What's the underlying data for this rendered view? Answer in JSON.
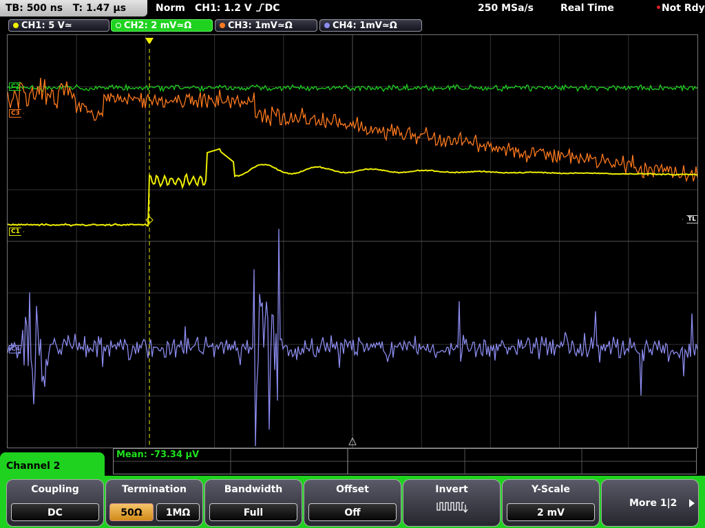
{
  "header": {
    "timebase": "TB: 500 ns",
    "trigger_time": "T: 1.47 µs",
    "mode": "Norm",
    "trigger_source": "CH1: 1.2 V",
    "trigger_slope_coupling": "DC",
    "sample_rate": "250 MSa/s",
    "acq_mode": "Real Time",
    "status": "Not Rdy."
  },
  "channels": [
    {
      "label": "CH1: 5 V≃",
      "color": "#f0f000"
    },
    {
      "label": "CH2: 2 mV≃Ω",
      "color": "#1fd21f"
    },
    {
      "label": "CH3: 1mV≃Ω",
      "color": "#ff7a1e"
    },
    {
      "label": "CH4: 1mV≃Ω",
      "color": "#8c8cf0"
    }
  ],
  "markers": {
    "c1": "C1",
    "c2": "C2",
    "c3": "C3",
    "c4": "C4",
    "trigger_level": "TL",
    "trigger_point": "T"
  },
  "measurement": {
    "mean": "Mean: -73.34 µV"
  },
  "menu": {
    "title": "Channel 2",
    "coupling": {
      "title": "Coupling",
      "value": "DC"
    },
    "termination": {
      "title": "Termination",
      "option_a": "50Ω",
      "option_b": "1MΩ"
    },
    "bandwidth": {
      "title": "Bandwidth",
      "value": "Full"
    },
    "offset": {
      "title": "Offset",
      "value": "Off"
    },
    "invert": {
      "title": "Invert",
      "icon": "inverted-square-wave-icon"
    },
    "yscale": {
      "title": "Y-Scale",
      "value": "2 mV"
    },
    "more": {
      "label": "More 1|2"
    }
  },
  "colors": {
    "ch1": "#f0f000",
    "ch2": "#1fd21f",
    "ch3": "#ff7a1e",
    "ch4": "#8c8cf0",
    "menu_accent": "#1fd21f",
    "selected_option": "#e8a83a"
  }
}
